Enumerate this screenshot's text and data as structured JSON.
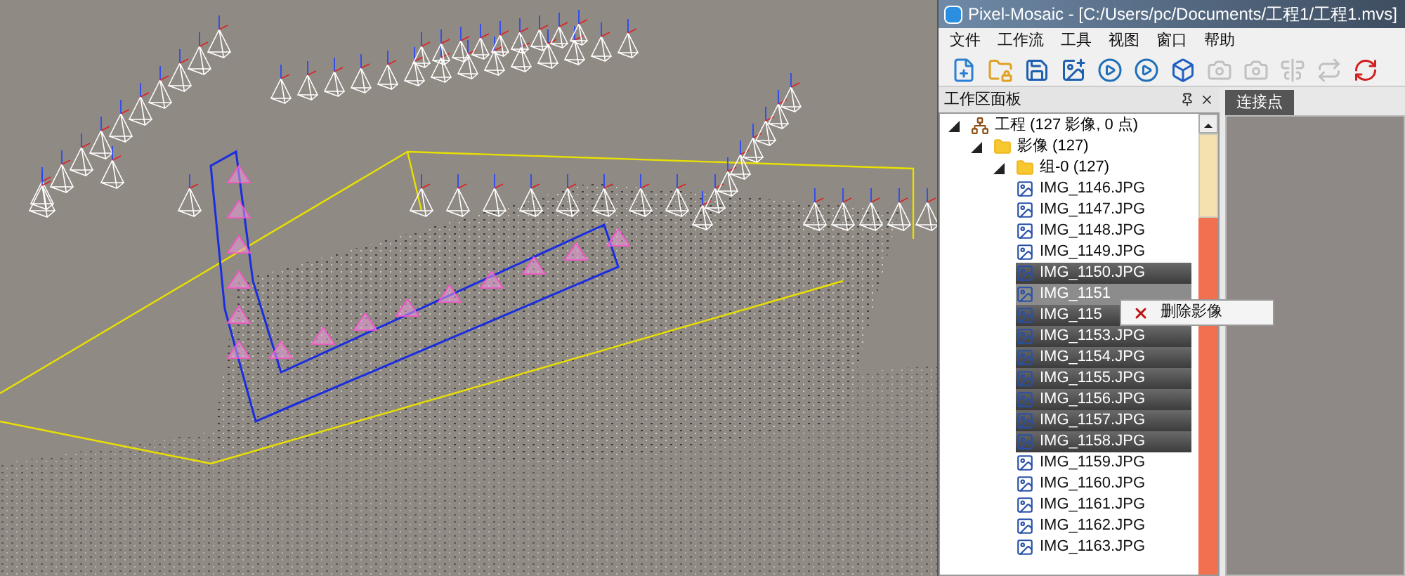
{
  "window": {
    "title": "Pixel-Mosaic - [C:/Users/pc/Documents/工程1/工程1.mvs]"
  },
  "menu": [
    "文件",
    "工作流",
    "工具",
    "视图",
    "窗口",
    "帮助"
  ],
  "toolbar": [
    {
      "kind": "new",
      "disabled": false
    },
    {
      "kind": "open",
      "disabled": false
    },
    {
      "kind": "save",
      "disabled": false
    },
    {
      "kind": "add-image",
      "disabled": false
    },
    {
      "kind": "run",
      "disabled": false
    },
    {
      "kind": "run",
      "disabled": false
    },
    {
      "kind": "cube",
      "disabled": false
    },
    {
      "kind": "camera",
      "disabled": true
    },
    {
      "kind": "camera",
      "disabled": true
    },
    {
      "kind": "align",
      "disabled": true
    },
    {
      "kind": "swap",
      "disabled": true
    },
    {
      "kind": "refresh",
      "disabled": false
    }
  ],
  "workspace_panel": {
    "title": "工作区面板",
    "tree": [
      {
        "label": "工程 (127 影像, 0 点)",
        "kind": "project",
        "expanded": true,
        "children": [
          {
            "label": "影像 (127)",
            "kind": "folder",
            "expanded": true,
            "children": [
              {
                "label": "组-0 (127)",
                "kind": "folder",
                "expanded": true,
                "children": [
                  {
                    "label": "IMG_1146.JPG",
                    "selected": false,
                    "focused": false
                  },
                  {
                    "label": "IMG_1147.JPG",
                    "selected": false,
                    "focused": false
                  },
                  {
                    "label": "IMG_1148.JPG",
                    "selected": false,
                    "focused": false
                  },
                  {
                    "label": "IMG_1149.JPG",
                    "selected": false,
                    "focused": false
                  },
                  {
                    "label": "IMG_1150.JPG",
                    "selected": true,
                    "focused": false
                  },
                  {
                    "label": "IMG_1151",
                    "selected": true,
                    "focused": true
                  },
                  {
                    "label": "IMG_115",
                    "selected": true,
                    "focused": false
                  },
                  {
                    "label": "IMG_1153.JPG",
                    "selected": true,
                    "focused": false
                  },
                  {
                    "label": "IMG_1154.JPG",
                    "selected": true,
                    "focused": false
                  },
                  {
                    "label": "IMG_1155.JPG",
                    "selected": true,
                    "focused": false
                  },
                  {
                    "label": "IMG_1156.JPG",
                    "selected": true,
                    "focused": false
                  },
                  {
                    "label": "IMG_1157.JPG",
                    "selected": true,
                    "focused": false
                  },
                  {
                    "label": "IMG_1158.JPG",
                    "selected": true,
                    "focused": false
                  },
                  {
                    "label": "IMG_1159.JPG",
                    "selected": false,
                    "focused": false
                  },
                  {
                    "label": "IMG_1160.JPG",
                    "selected": false,
                    "focused": false
                  },
                  {
                    "label": "IMG_1161.JPG",
                    "selected": false,
                    "focused": false
                  },
                  {
                    "label": "IMG_1162.JPG",
                    "selected": false,
                    "focused": false
                  },
                  {
                    "label": "IMG_1163.JPG",
                    "selected": false,
                    "focused": false
                  }
                ]
              }
            ]
          }
        ]
      }
    ]
  },
  "context_menu": {
    "items": [
      "删除影像"
    ]
  },
  "tabs": [
    {
      "label": "连接点",
      "selected": true
    }
  ]
}
